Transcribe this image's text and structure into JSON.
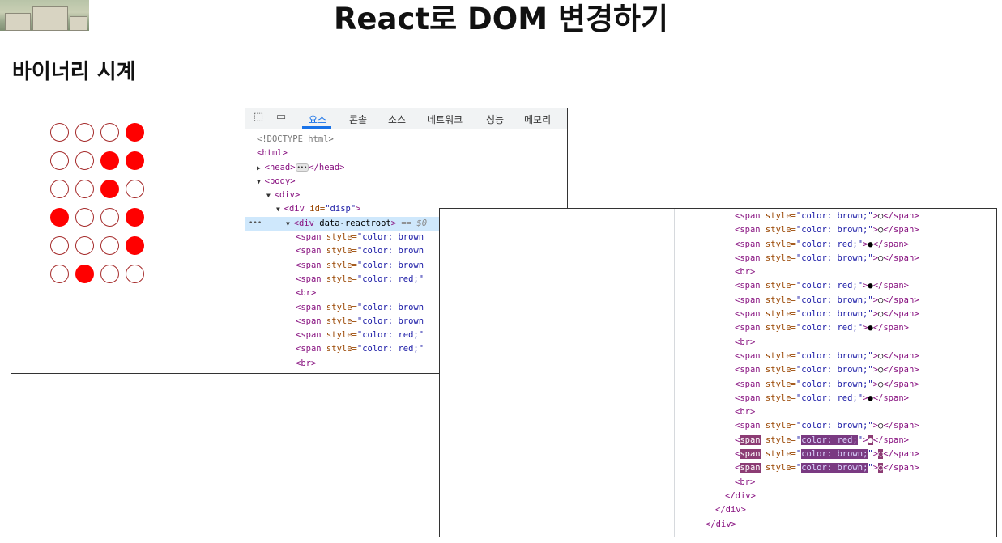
{
  "slide": {
    "title": "React로 DOM 변경하기",
    "section": "바이너리 시계"
  },
  "clock": {
    "rows": [
      [
        0,
        0,
        0,
        1
      ],
      [
        0,
        0,
        1,
        1
      ],
      [
        0,
        0,
        1,
        0
      ],
      [
        1,
        0,
        0,
        1
      ],
      [
        0,
        0,
        0,
        1
      ],
      [
        0,
        1,
        0,
        0
      ]
    ],
    "on_color": "#ff0000",
    "off_color": "#a52a2a"
  },
  "devtools": {
    "tools": [
      "inspect-icon",
      "device-toggle-icon"
    ],
    "tabs": [
      "요소",
      "콘솔",
      "소스",
      "네트워크",
      "성능",
      "메모리"
    ],
    "active_tab": "요소",
    "lines": [
      {
        "indent": 0,
        "text": "<!DOCTYPE html>",
        "kind": "doc"
      },
      {
        "indent": 0,
        "text": "<html>",
        "kind": "tag"
      },
      {
        "indent": 0,
        "arrow": "▶",
        "text": "<head>",
        "ellipsis": true,
        "tail": "</head>",
        "kind": "tag"
      },
      {
        "indent": 0,
        "arrow": "▼",
        "text": "<body>",
        "kind": "tag"
      },
      {
        "indent": 1,
        "arrow": "▼",
        "text": "<div>",
        "kind": "tag"
      },
      {
        "indent": 2,
        "arrow": "▼",
        "text": "<div id=\"disp\">",
        "kind": "tag"
      },
      {
        "indent": 3,
        "arrow": "▼",
        "text": "<div data-reactroot>",
        "suffix": " == $0",
        "kind": "tag",
        "selected": true
      },
      {
        "indent": 4,
        "text": "<span style=\"color: brown",
        "kind": "tag"
      },
      {
        "indent": 4,
        "text": "<span style=\"color: brown",
        "kind": "tag"
      },
      {
        "indent": 4,
        "text": "<span style=\"color: brown",
        "kind": "tag"
      },
      {
        "indent": 4,
        "text": "<span style=\"color: red;\"",
        "kind": "tag"
      },
      {
        "indent": 4,
        "text": "<br>",
        "kind": "tag"
      },
      {
        "indent": 4,
        "text": "<span style=\"color: brown",
        "kind": "tag"
      },
      {
        "indent": 4,
        "text": "<span style=\"color: brown",
        "kind": "tag"
      },
      {
        "indent": 4,
        "text": "<span style=\"color: red;\"",
        "kind": "tag"
      },
      {
        "indent": 4,
        "text": "<span style=\"color: red;\"",
        "kind": "tag"
      },
      {
        "indent": 4,
        "text": "<br>",
        "kind": "tag"
      }
    ]
  },
  "code_zoom": {
    "lines": [
      {
        "indent": 3,
        "text": "<span style=\"color: brown;\">○</span>"
      },
      {
        "indent": 3,
        "text": "<span style=\"color: brown;\">○</span>"
      },
      {
        "indent": 3,
        "text": "<span style=\"color: red;\">●</span>"
      },
      {
        "indent": 3,
        "text": "<span style=\"color: brown;\">○</span>"
      },
      {
        "indent": 3,
        "text": "<br>"
      },
      {
        "indent": 3,
        "text": "<span style=\"color: red;\">●</span>"
      },
      {
        "indent": 3,
        "text": "<span style=\"color: brown;\">○</span>"
      },
      {
        "indent": 3,
        "text": "<span style=\"color: brown;\">○</span>"
      },
      {
        "indent": 3,
        "text": "<span style=\"color: red;\">●</span>"
      },
      {
        "indent": 3,
        "text": "<br>"
      },
      {
        "indent": 3,
        "text": "<span style=\"color: brown;\">○</span>"
      },
      {
        "indent": 3,
        "text": "<span style=\"color: brown;\">○</span>"
      },
      {
        "indent": 3,
        "text": "<span style=\"color: brown;\">○</span>"
      },
      {
        "indent": 3,
        "text": "<span style=\"color: red;\">●</span>"
      },
      {
        "indent": 3,
        "text": "<br>"
      },
      {
        "indent": 3,
        "text": "<span style=\"color: brown;\">○</span>"
      },
      {
        "indent": 3,
        "text": "<span style=\"color: red;\">●</span>",
        "flash": true
      },
      {
        "indent": 3,
        "text": "<span style=\"color: brown;\">○</span>",
        "flash": true
      },
      {
        "indent": 3,
        "text": "<span style=\"color: brown;\">○</span>",
        "flash": true
      },
      {
        "indent": 3,
        "text": "<br>"
      },
      {
        "indent": 2,
        "text": "</div>"
      },
      {
        "indent": 1,
        "text": "</div>"
      },
      {
        "indent": 0,
        "text": "</div>"
      }
    ]
  }
}
